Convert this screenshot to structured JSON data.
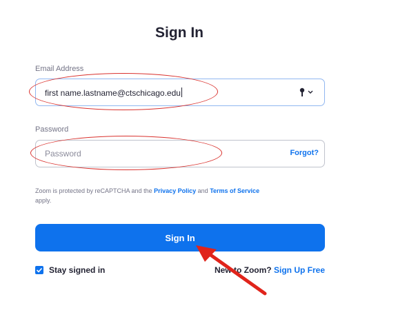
{
  "form": {
    "title": "Sign In",
    "email_label": "Email Address",
    "email_value": "first name.lastname@ctschicago.edu",
    "password_label": "Password",
    "password_placeholder": "Password",
    "forgot_label": "Forgot?",
    "recaptcha_prefix": "Zoom is protected by reCAPTCHA and the",
    "privacy_policy": "Privacy Policy",
    "and_text": "and",
    "terms_of_service": "Terms of Service",
    "recaptcha_suffix": "apply.",
    "signin_button": "Sign In",
    "stay_signed_in": "Stay signed in",
    "stay_signed_in_checked": true,
    "new_to_zoom": "New to Zoom?",
    "signup_link": "Sign Up Free"
  },
  "colors": {
    "accent": "#0e72ed",
    "annotation": "#d9302c",
    "text": "#232333",
    "muted": "#747487"
  }
}
